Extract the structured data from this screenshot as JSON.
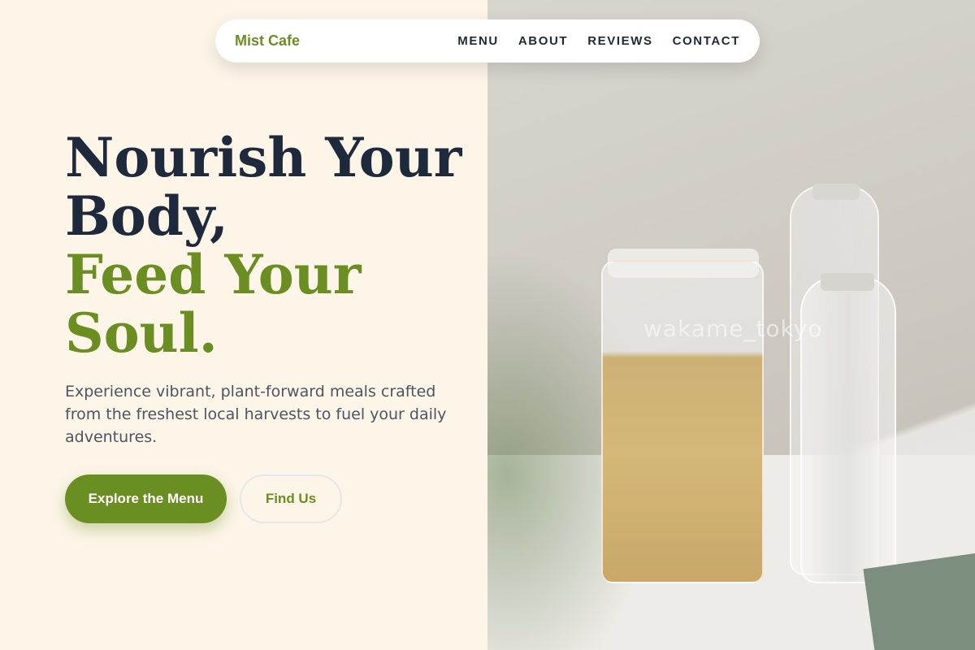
{
  "nav": {
    "brand": "Mist Cafe",
    "links": [
      "MENU",
      "ABOUT",
      "REVIEWS",
      "CONTACT"
    ]
  },
  "hero": {
    "title_line1": "Nourish Your",
    "title_line2": "Body,",
    "title_accent_line1": "Feed Your",
    "title_accent_line2": "Soul.",
    "subtitle": "Experience vibrant, plant-forward meals crafted from the freshest local harvests to fuel your daily adventures.",
    "primary_button": "Explore the Menu",
    "secondary_button": "Find Us"
  },
  "photo": {
    "watermark": "wakame_tokyo"
  },
  "colors": {
    "accent": "#6b8e23",
    "heading": "#1e2a3b",
    "background": "#fdf5e8"
  }
}
